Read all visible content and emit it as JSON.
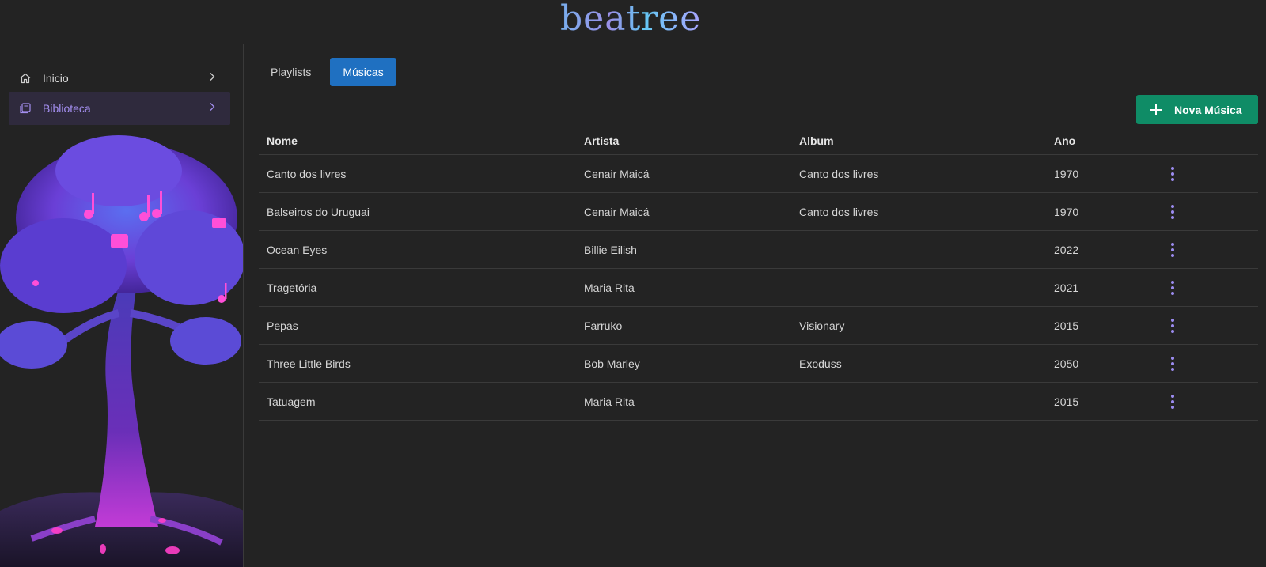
{
  "app": {
    "logo_text": "beatree"
  },
  "sidebar": {
    "items": [
      {
        "label": "Inicio",
        "icon": "home-icon",
        "active": false
      },
      {
        "label": "Biblioteca",
        "icon": "library-icon",
        "active": true
      }
    ]
  },
  "tabs": [
    {
      "label": "Playlists",
      "active": false
    },
    {
      "label": "Músicas",
      "active": true
    }
  ],
  "actions": {
    "new_song_label": "Nova Música"
  },
  "table": {
    "headers": {
      "nome": "Nome",
      "artista": "Artista",
      "album": "Album",
      "ano": "Ano"
    },
    "rows": [
      {
        "nome": "Canto dos livres",
        "artista": "Cenair Maicá",
        "album": "Canto dos livres",
        "ano": "1970"
      },
      {
        "nome": "Balseiros do Uruguai",
        "artista": "Cenair Maicá",
        "album": "Canto dos livres",
        "ano": "1970"
      },
      {
        "nome": "Ocean Eyes",
        "artista": "Billie Eilish",
        "album": "",
        "ano": "2022"
      },
      {
        "nome": "Tragetória",
        "artista": "Maria Rita",
        "album": "",
        "ano": "2021"
      },
      {
        "nome": "Pepas",
        "artista": "Farruko",
        "album": "Visionary",
        "ano": "2015"
      },
      {
        "nome": "Three Little Birds",
        "artista": "Bob Marley",
        "album": "Exoduss",
        "ano": "2050"
      },
      {
        "nome": "Tatuagem",
        "artista": "Maria Rita",
        "album": "",
        "ano": "2015"
      }
    ]
  },
  "colors": {
    "background": "#232323",
    "accent_blue": "#1f70c1",
    "accent_green": "#0f8c66",
    "accent_purple": "#a48ff0"
  }
}
